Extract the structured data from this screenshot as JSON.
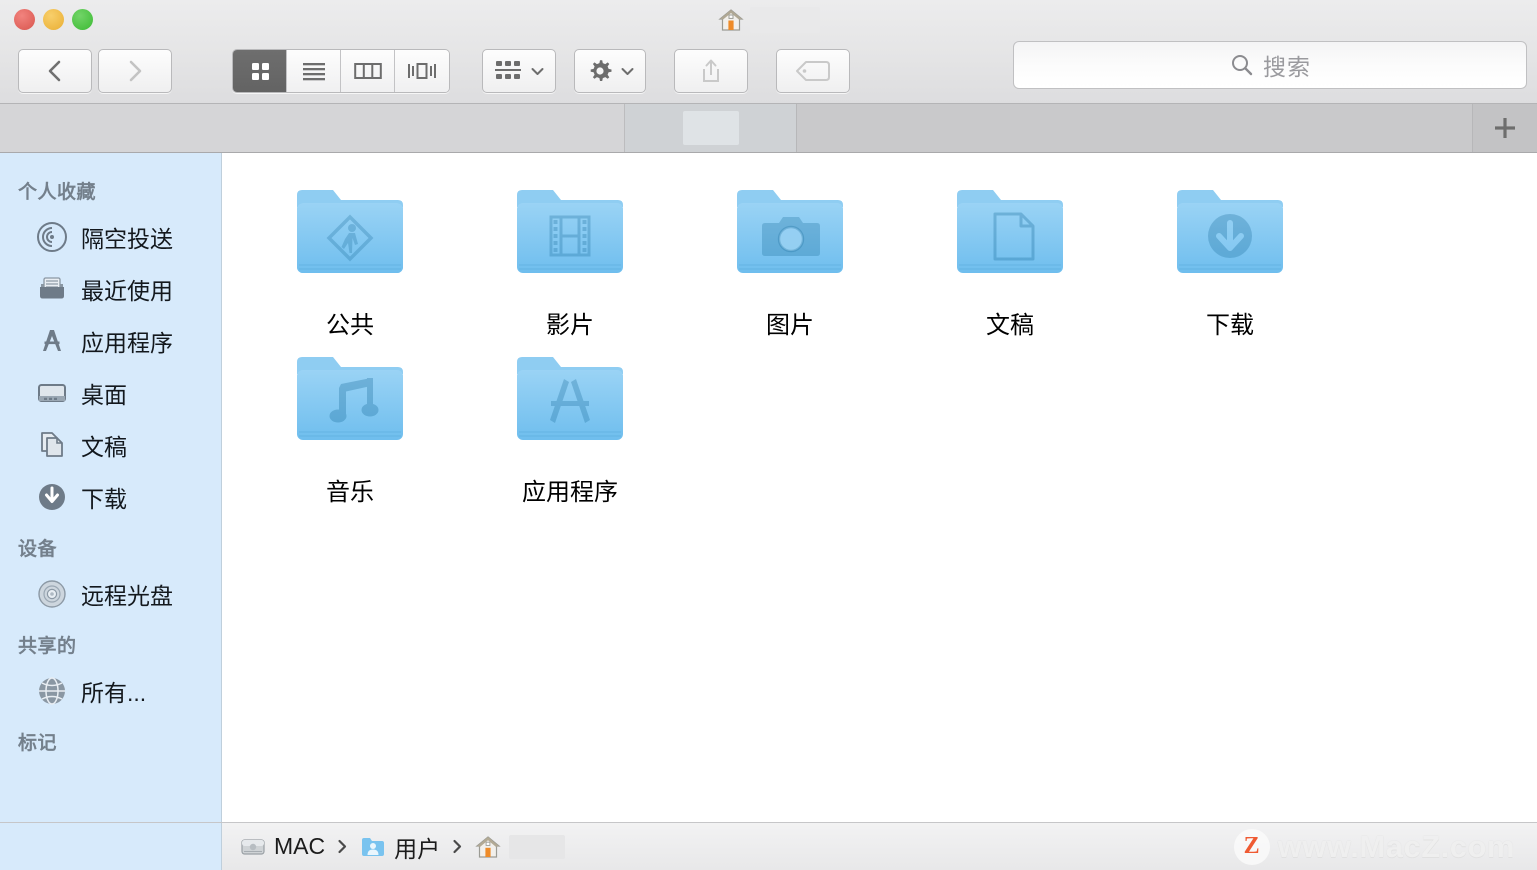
{
  "window": {
    "title_redacted": true,
    "title_icon": "home-icon",
    "traffic_lights": [
      {
        "name": "close-button",
        "color": "#e0635c"
      },
      {
        "name": "minimize-button",
        "color": "#eeb844"
      },
      {
        "name": "zoom-button",
        "color": "#4cc243"
      }
    ]
  },
  "toolbar": {
    "back_label": "",
    "forward_label": "",
    "view_modes": [
      {
        "name": "icon-view",
        "icon": "grid-icon",
        "active": true
      },
      {
        "name": "list-view",
        "icon": "list-icon",
        "active": false
      },
      {
        "name": "column-view",
        "icon": "columns-icon",
        "active": false
      },
      {
        "name": "coverflow-view",
        "icon": "coverflow-icon",
        "active": false
      }
    ],
    "arrange_icon": "arrange-icon",
    "action_icon": "gear-icon",
    "share_icon": "share-icon",
    "tag_icon": "tag-icon"
  },
  "search": {
    "placeholder": "搜索",
    "value": "",
    "icon": "search-icon"
  },
  "tabbar": {
    "tabs": [
      {
        "label": "",
        "redacted": true,
        "active": true
      }
    ],
    "new_tab_label": "+"
  },
  "sidebar": {
    "sections": [
      {
        "header": "个人收藏",
        "items": [
          {
            "label": "隔空投送",
            "icon": "airdrop-icon"
          },
          {
            "label": "最近使用",
            "icon": "recents-icon"
          },
          {
            "label": "应用程序",
            "icon": "applications-icon"
          },
          {
            "label": "桌面",
            "icon": "desktop-icon"
          },
          {
            "label": "文稿",
            "icon": "documents-icon"
          },
          {
            "label": "下载",
            "icon": "downloads-icon"
          }
        ]
      },
      {
        "header": "设备",
        "items": [
          {
            "label": "远程光盘",
            "icon": "disc-icon"
          }
        ]
      },
      {
        "header": "共享的",
        "items": [
          {
            "label": "所有...",
            "icon": "network-globe-icon"
          }
        ]
      },
      {
        "header": "标记",
        "items": []
      }
    ]
  },
  "main": {
    "items": [
      {
        "label": "公共",
        "icon": "folder-public-icon"
      },
      {
        "label": "影片",
        "icon": "folder-movies-icon"
      },
      {
        "label": "图片",
        "icon": "folder-pictures-icon"
      },
      {
        "label": "文稿",
        "icon": "folder-documents-icon"
      },
      {
        "label": "下载",
        "icon": "folder-downloads-icon"
      },
      {
        "label": "音乐",
        "icon": "folder-music-icon"
      },
      {
        "label": "应用程序",
        "icon": "folder-applications-icon"
      }
    ]
  },
  "pathbar": {
    "crumbs": [
      {
        "label": "MAC",
        "icon": "harddisk-icon",
        "redacted": false
      },
      {
        "label": "用户",
        "icon": "users-folder-icon",
        "redacted": false
      },
      {
        "label": "",
        "icon": "home-icon",
        "redacted": true
      }
    ]
  },
  "watermark": {
    "badge": "Z",
    "text": "www.MacZ.com"
  },
  "colors": {
    "sidebar_bg": "#d7eafb",
    "folder_blue": "#79c3ef",
    "accent_orange": "#f04e23",
    "toolbar_bg": "#e6e6e7"
  }
}
